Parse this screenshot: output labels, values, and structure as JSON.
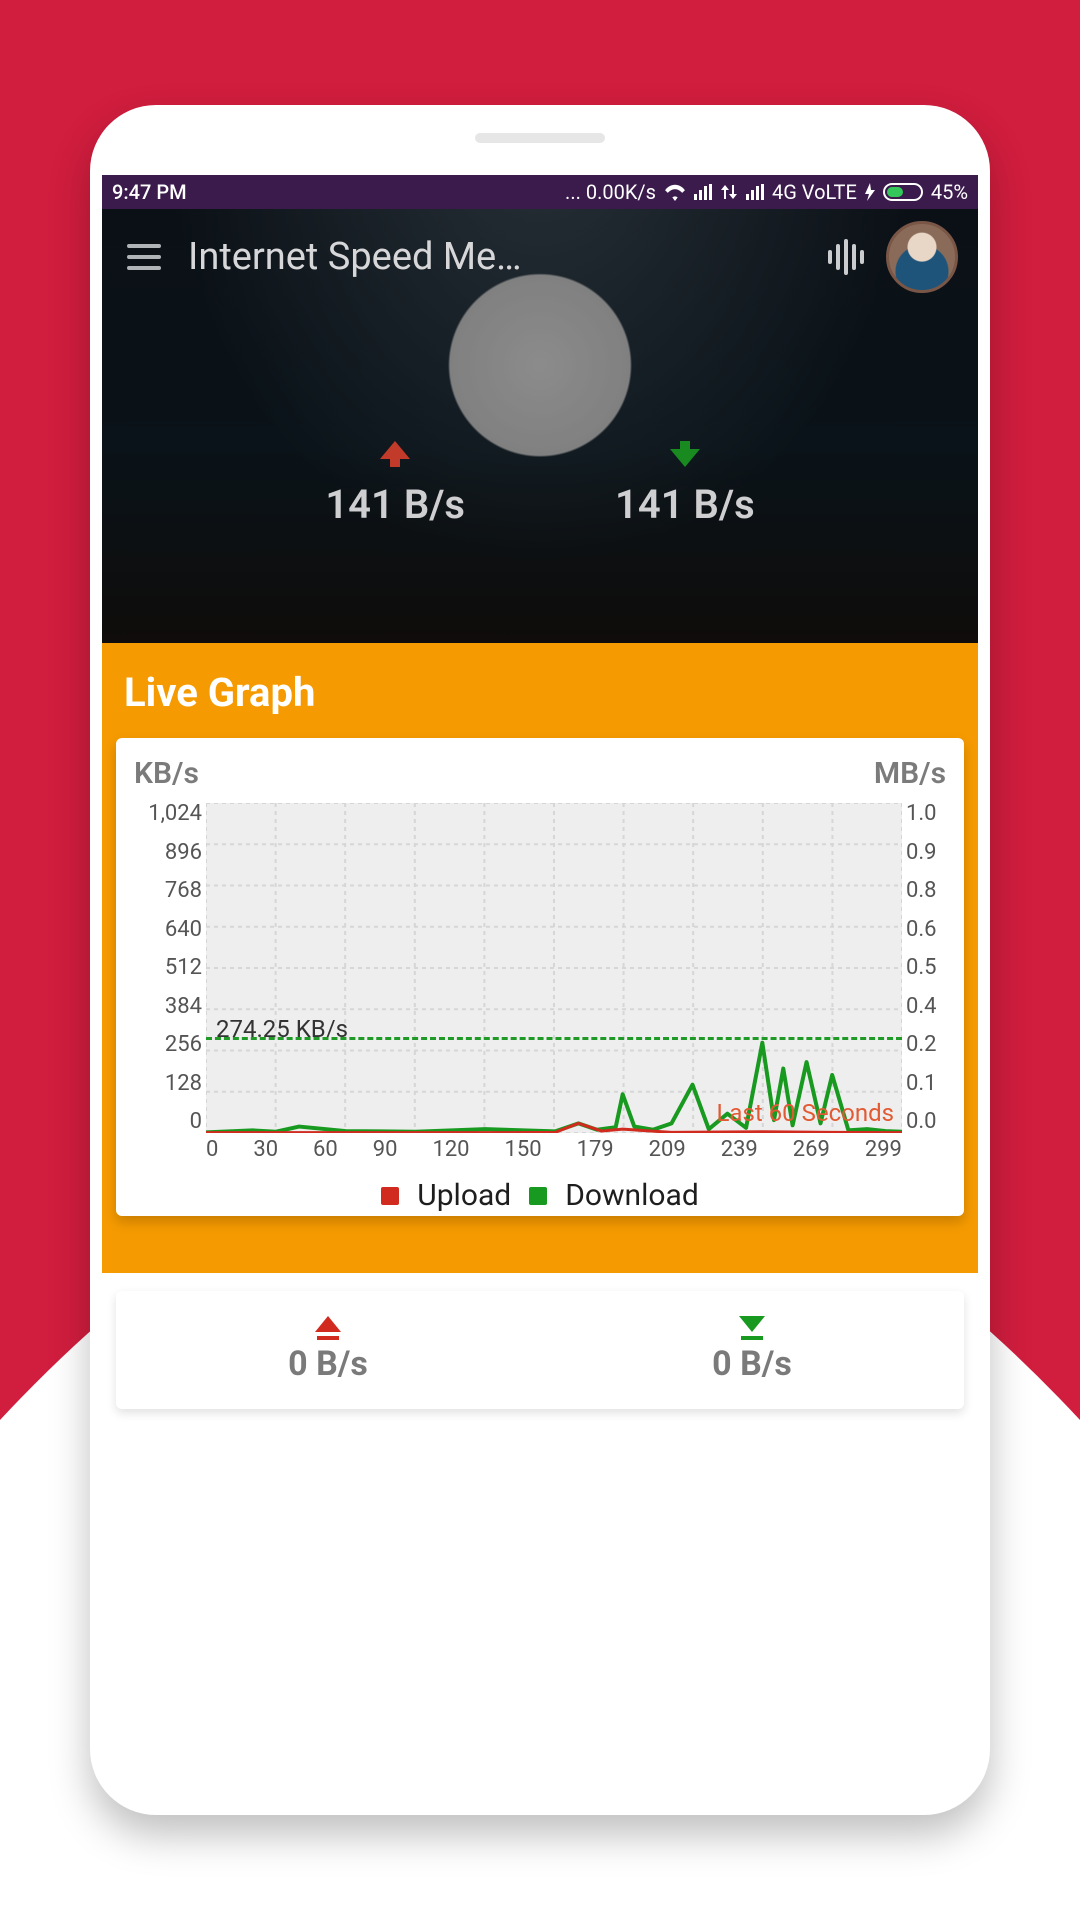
{
  "statusbar": {
    "time": "9:47 PM",
    "netspeed": "0.00K/s",
    "network_label": "4G VoLTE",
    "battery_percent": "45%"
  },
  "app": {
    "title": "Internet Speed Me…"
  },
  "hero": {
    "upload_value": "141 B/s",
    "download_value": "141 B/s"
  },
  "section": {
    "title": "Live Graph"
  },
  "chart": {
    "left_axis_title": "KB/s",
    "right_axis_title": "MB/s",
    "annotation": "274.25 KB/s",
    "last_window_label": "Last 60 Seconds",
    "legend_upload": "Upload",
    "legend_download": "Download",
    "y_left_ticks": [
      "1,024",
      "896",
      "768",
      "640",
      "512",
      "384",
      "256",
      "128",
      "0"
    ],
    "y_right_ticks": [
      "1.0",
      "0.9",
      "0.8",
      "0.6",
      "0.5",
      "0.4",
      "0.2",
      "0.1",
      "0.0"
    ],
    "x_ticks": [
      "0",
      "30",
      "60",
      "90",
      "120",
      "150",
      "179",
      "209",
      "239",
      "269",
      "299"
    ]
  },
  "bottom": {
    "upload_value": "0 B/s",
    "download_value": "0 B/s"
  },
  "chart_data": {
    "type": "line",
    "x_range": [
      0,
      299
    ],
    "ylabel_left": "KB/s",
    "ylabel_right": "MB/s",
    "ylim_left": [
      0,
      1024
    ],
    "ylim_right": [
      0.0,
      1.0
    ],
    "reference_line_kbps": 274.25,
    "series": [
      {
        "name": "Download",
        "color": "#18991f",
        "x": [
          0,
          20,
          30,
          40,
          60,
          90,
          120,
          150,
          160,
          168,
          176,
          179,
          184,
          192,
          200,
          209,
          216,
          224,
          232,
          239,
          244,
          248,
          252,
          258,
          264,
          269,
          276,
          284,
          292,
          299
        ],
        "y_kbps": [
          2,
          8,
          4,
          20,
          6,
          4,
          12,
          5,
          30,
          10,
          18,
          120,
          20,
          10,
          30,
          150,
          12,
          60,
          16,
          280,
          40,
          200,
          24,
          220,
          30,
          180,
          8,
          12,
          6,
          4
        ]
      },
      {
        "name": "Upload",
        "color": "#d12b1f",
        "x": [
          0,
          60,
          120,
          150,
          160,
          170,
          179,
          200,
          239,
          269,
          299
        ],
        "y_kbps": [
          1,
          1,
          1,
          2,
          30,
          6,
          12,
          2,
          4,
          2,
          1
        ]
      }
    ]
  }
}
